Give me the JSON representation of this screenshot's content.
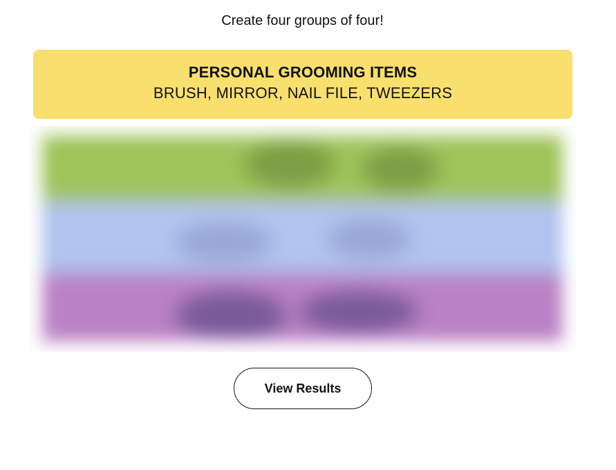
{
  "instructions": "Create four groups of four!",
  "solved_groups": [
    {
      "category": "PERSONAL GROOMING ITEMS",
      "members": "BRUSH, MIRROR, NAIL FILE, TWEEZERS",
      "color": "#f9df6d"
    }
  ],
  "hidden_rows": [
    {
      "color": "#a0c35a",
      "dark": "#7f9e45"
    },
    {
      "color": "#b0c4ef",
      "dark": "#98a7d6"
    },
    {
      "color": "#ba81c5",
      "dark": "#7a5a9a"
    }
  ],
  "actions": {
    "view_results": "View Results"
  }
}
